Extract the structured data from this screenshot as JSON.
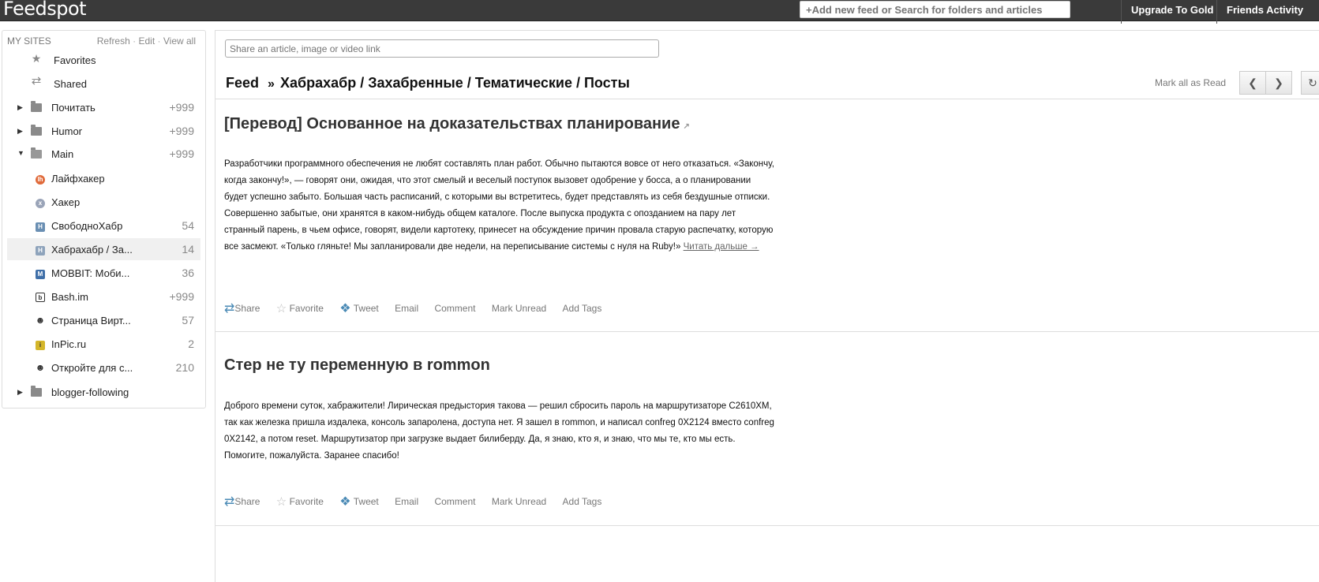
{
  "topbar": {
    "logo": "Feedspot",
    "search_placeholder": "+Add new feed or Search for folders and articles",
    "upgrade": "Upgrade To Gold",
    "friends": "Friends Activity"
  },
  "sidebar": {
    "heading": "MY SITES",
    "refresh": "Refresh",
    "edit": "Edit",
    "view_all": "View all",
    "sep": "·",
    "items": [
      {
        "label": "Favorites",
        "count": "",
        "icon": "star-icon"
      },
      {
        "label": "Shared",
        "count": "",
        "icon": "share-icon"
      },
      {
        "label": "Почитать",
        "count": "+999",
        "icon": "folder-icon"
      },
      {
        "label": "Humor",
        "count": "+999",
        "icon": "folder-icon"
      },
      {
        "label": "Main",
        "count": "+999",
        "icon": "folder-open-icon"
      },
      {
        "label": "Лайфхакер",
        "count": "",
        "icon": "lifehacker-icon"
      },
      {
        "label": "Хакер",
        "count": "",
        "icon": "xakep-icon"
      },
      {
        "label": "СвободноХабр",
        "count": "54",
        "icon": "habr-icon"
      },
      {
        "label": "Хабрахабр / За...",
        "count": "14",
        "icon": "habr-icon"
      },
      {
        "label": "MOBBIT: Моби...",
        "count": "36",
        "icon": "mobbit-icon"
      },
      {
        "label": "Bash.im",
        "count": "+999",
        "icon": "bash-icon"
      },
      {
        "label": "Страница Вирт...",
        "count": "57",
        "icon": "person-icon"
      },
      {
        "label": "InPic.ru",
        "count": "2",
        "icon": "inpic-icon"
      },
      {
        "label": "Откройте для с...",
        "count": "210",
        "icon": "person-icon"
      },
      {
        "label": "blogger-following",
        "count": "",
        "icon": "folder-icon"
      }
    ]
  },
  "main": {
    "share_placeholder": "Share an article, image or video link",
    "crumb_feed": "Feed",
    "crumb_arrow": "»",
    "crumb_path": "Хабрахабр / Захабренные / Тематические / Посты",
    "mark_all": "Mark all as Read",
    "articles": [
      {
        "title": "[Перевод] Основанное на доказательствах планирование",
        "body": "Разработчики программного обеспечения не любят составлять план работ. Обычно пытаются вовсе от него отказаться. «Закончу, когда закончу!», — говорят они, ожидая, что этот смелый и веселый поступок вызовет одобрение у босса, а о планировании будет успешно забыто. Большая часть расписаний, с которыми вы встретитесь, будет представлять из себя бездушные отписки. Совершенно забытые, они хранятся в каком-нибудь общем каталоге. После выпуска продукта с опозданием на пару лет странный парень, в чьем офисе, говорят, видели картотеку, принесет на обсуждение причин провала старую распечатку, которую все засмеют. «Только гляньте! Мы запланировали две недели, на переписывание системы с нуля на Ruby!»",
        "read_more": "Читать дальше →"
      },
      {
        "title": "Стер не ту переменную в rommon",
        "body": "Доброго времени суток, хабражители! Лирическая предыстория такова — решил сбросить пароль на маршрутизаторе C2610XM, так как железка пришла издалека, консоль запаролена, доступа нет. Я зашел в rommon, и написал confreg 0X2124 вместо confreg 0X2142, а потом reset. Маршрутизатор при загрузке выдает билиберду. Да, я знаю, кто я, и знаю, что мы те, кто мы есть. Помогите, пожалуйста. Заранее спасибо!",
        "read_more": ""
      }
    ],
    "actions": {
      "share": "Share",
      "favorite": "Favorite",
      "tweet": "Tweet",
      "email": "Email",
      "comment": "Comment",
      "mark_unread": "Mark Unread",
      "add_tags": "Add Tags"
    }
  }
}
